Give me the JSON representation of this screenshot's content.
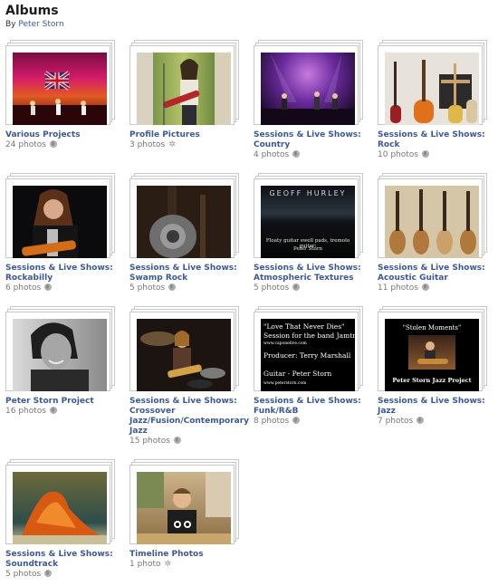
{
  "page": {
    "title": "Albums",
    "by_label": "By",
    "owner": "Peter Storn"
  },
  "albums": [
    {
      "title": "Various Projects",
      "meta": "24 photos",
      "privacy_icon": "globe-icon"
    },
    {
      "title": "Profile Pictures",
      "meta": "3 photos",
      "privacy_icon": "gear-icon"
    },
    {
      "title": "Sessions & Live Shows: Country",
      "meta": "4 photos",
      "privacy_icon": "globe-icon"
    },
    {
      "title": "Sessions & Live Shows: Rock",
      "meta": "10 photos",
      "privacy_icon": "globe-icon"
    },
    {
      "title": "Sessions & Live Shows: Rockabilly",
      "meta": "6 photos",
      "privacy_icon": "globe-icon"
    },
    {
      "title": "Sessions & Live Shows: Swamp Rock",
      "meta": "5 photos",
      "privacy_icon": "globe-icon"
    },
    {
      "title": "Sessions & Live Shows: Atmospheric Textures",
      "meta": "5 photos",
      "privacy_icon": "globe-icon",
      "cover_text": {
        "line1": "GEOFF HURLEY",
        "line2": "Floaty guitar swell pads, tremolo guitar:",
        "line3": "Peter Storn"
      }
    },
    {
      "title": "Sessions & Live Shows: Acoustic Guitar",
      "meta": "11 photos",
      "privacy_icon": "globe-icon"
    },
    {
      "title": "Peter Storn Project",
      "meta": "16 photos",
      "privacy_icon": "globe-icon"
    },
    {
      "title": "Sessions & Live Shows: Crossover Jazz/Fusion/Contemporary Jazz",
      "meta": "15 photos",
      "privacy_icon": "globe-icon"
    },
    {
      "title": "Sessions & Live Shows: Funk/R&B",
      "meta": "8 photos",
      "privacy_icon": "globe-icon",
      "cover_text": {
        "line1": "\"Love That Never Dies\"",
        "line2": "Session for the band Jamtra",
        "line3": "www.caponelive.com",
        "line4": "Producer: Terry Marshall",
        "line5": "Guitar - Peter Storn",
        "line6": "www.peterstorn.com"
      }
    },
    {
      "title": "Sessions & Live Shows: Jazz",
      "meta": "7 photos",
      "privacy_icon": "globe-icon",
      "cover_text": {
        "line1": "\"Stolen Moments\"",
        "line2": "Peter Storn Jazz Project"
      }
    },
    {
      "title": "Sessions & Live Shows: Soundtrack",
      "meta": "5 photos",
      "privacy_icon": "globe-icon"
    },
    {
      "title": "Timeline Photos",
      "meta": "1 photo",
      "privacy_icon": "gear-icon"
    }
  ],
  "colors": {
    "link": "#3b5998",
    "meta": "#777777"
  }
}
